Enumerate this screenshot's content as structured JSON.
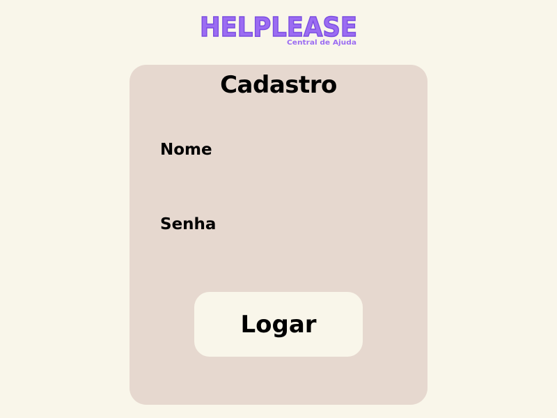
{
  "brand": {
    "name": "HELPLEASE",
    "tagline": "Central de Ajuda",
    "color": "#9b6cf2"
  },
  "form": {
    "title": "Cadastro",
    "fields": [
      {
        "label": "Nome",
        "value": "",
        "type": "text"
      },
      {
        "label": "Senha",
        "value": "",
        "type": "password"
      }
    ],
    "submit_label": "Logar"
  },
  "colors": {
    "background": "#f9f6ea",
    "card": "#e6d8cf",
    "button": "#f9f6ea",
    "text": "#000000"
  }
}
